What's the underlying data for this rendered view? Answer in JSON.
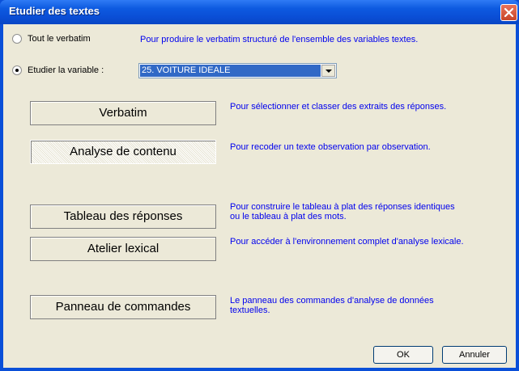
{
  "window": {
    "title": "Etudier des textes"
  },
  "radios": {
    "all_label": "Tout le verbatim",
    "all_desc": "Pour produire le verbatim structuré de l'ensemble des variables textes.",
    "var_label": "Etudier la variable :",
    "selected_variable": "25. VOITURE IDEALE"
  },
  "actions": [
    {
      "label": "Verbatim",
      "desc": "Pour sélectionner et classer des extraits des réponses."
    },
    {
      "label": "Analyse de contenu",
      "desc": "Pour recoder un texte observation par observation."
    },
    {
      "label": "Tableau des réponses",
      "desc_line1": "Pour construire le tableau à plat des réponses identiques",
      "desc_line2": "ou le tableau à plat des mots."
    },
    {
      "label": "Atelier lexical",
      "desc": "Pour accéder à l'environnement complet d'analyse lexicale."
    },
    {
      "label": "Panneau de commandes",
      "desc_line1": "Le panneau des commandes d'analyse de données",
      "desc_line2": "textuelles."
    }
  ],
  "footer": {
    "ok_label": "OK",
    "cancel_label": "Annuler"
  },
  "colors": {
    "title_bar": "#0a4ed6",
    "dialog_bg": "#ece9d8",
    "desc_text": "#0000ee",
    "selection": "#3169c6"
  }
}
